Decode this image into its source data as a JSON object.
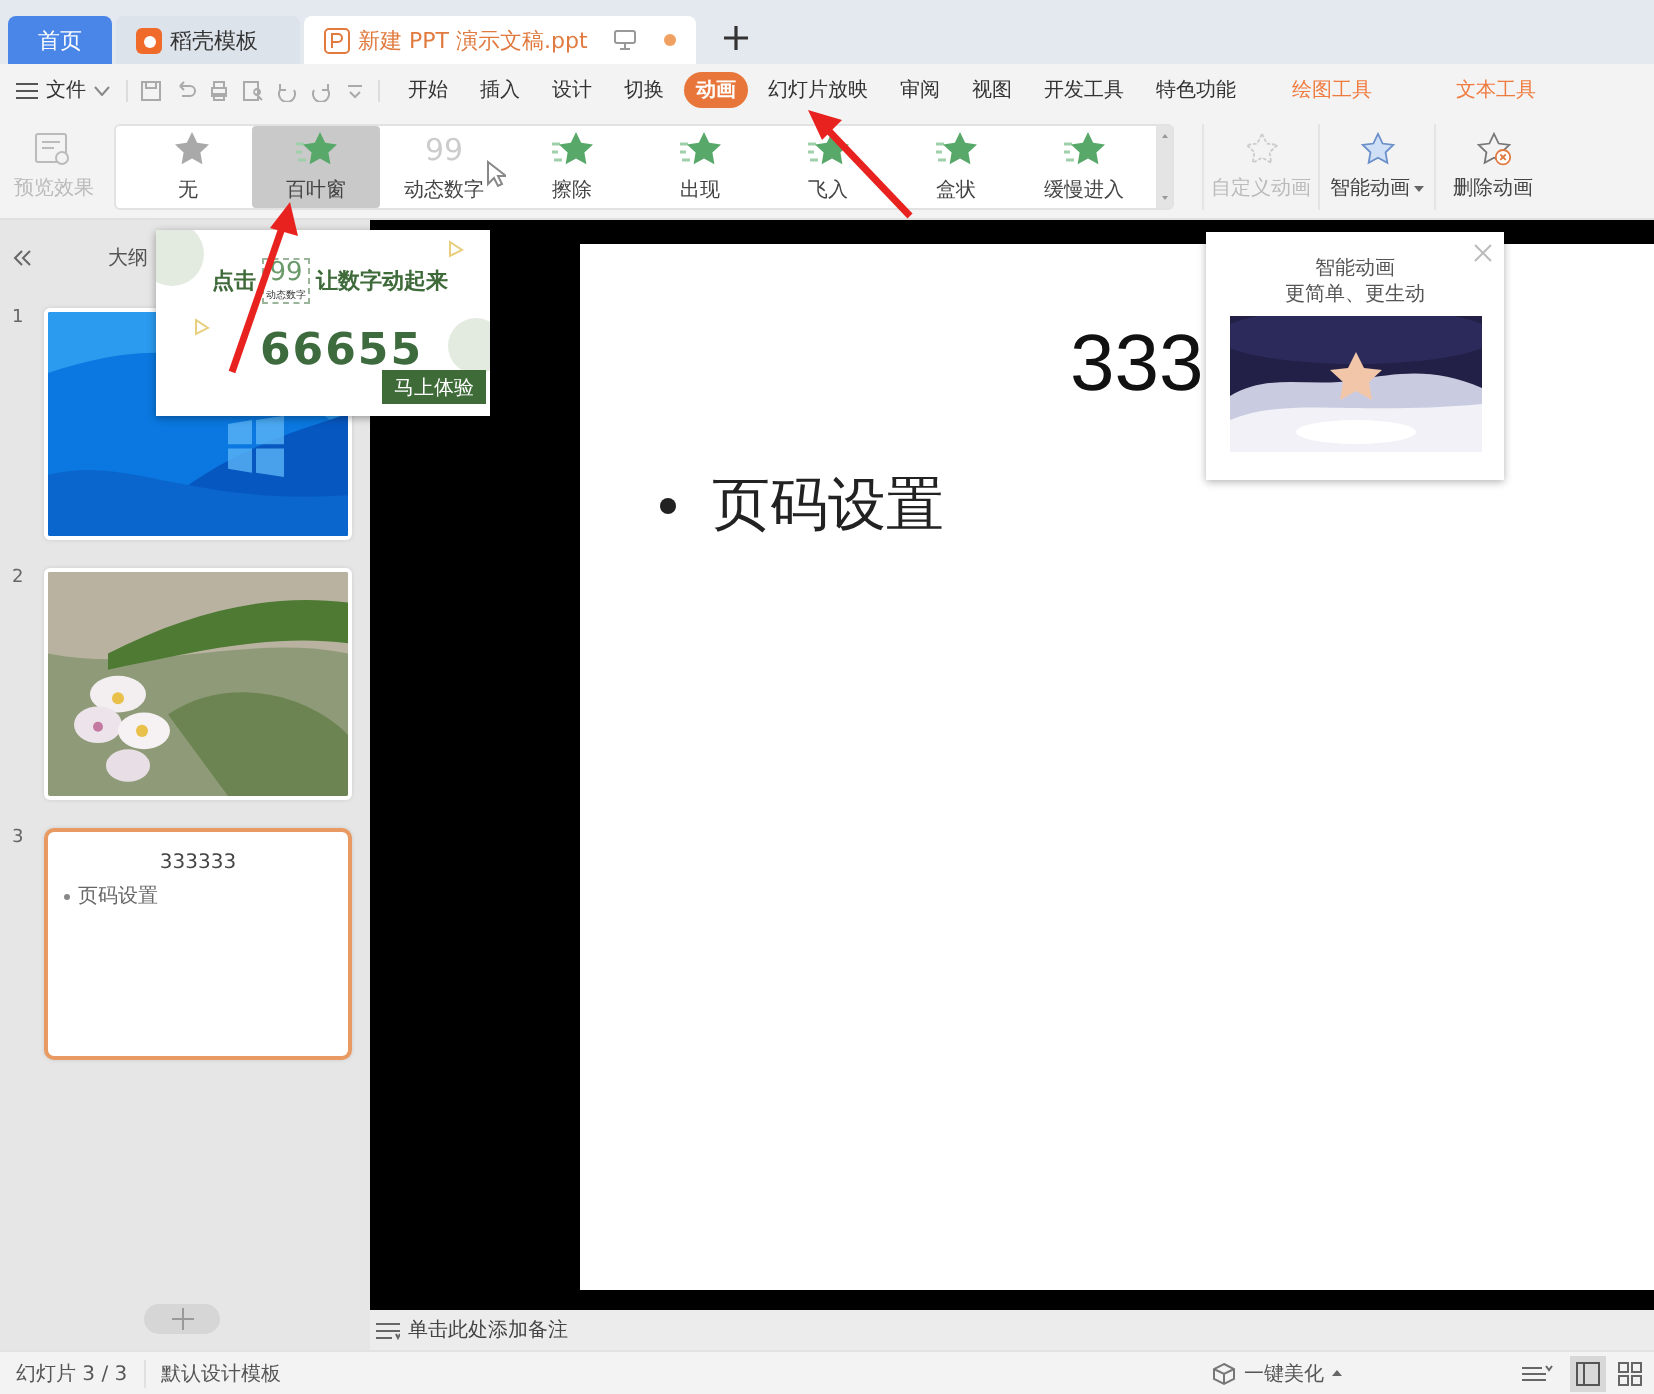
{
  "tabs": [
    {
      "label": "首页",
      "kind": "home",
      "selected": false
    },
    {
      "label": "稻壳模板",
      "kind": "store",
      "selected": false
    },
    {
      "label": "新建 PPT 演示文稿.ppt",
      "kind": "doc",
      "selected": true
    }
  ],
  "menu": {
    "file": "文件",
    "items": [
      {
        "label": "开始",
        "kind": "main",
        "selected": false
      },
      {
        "label": "插入",
        "kind": "main",
        "selected": false
      },
      {
        "label": "设计",
        "kind": "main",
        "selected": false
      },
      {
        "label": "切换",
        "kind": "main",
        "selected": false
      },
      {
        "label": "动画",
        "kind": "main",
        "selected": true
      },
      {
        "label": "幻灯片放映",
        "kind": "main",
        "selected": false
      },
      {
        "label": "审阅",
        "kind": "main",
        "selected": false
      },
      {
        "label": "视图",
        "kind": "main",
        "selected": false
      },
      {
        "label": "开发工具",
        "kind": "main",
        "selected": false
      },
      {
        "label": "特色功能",
        "kind": "main",
        "selected": false
      },
      {
        "label": "绘图工具",
        "kind": "context",
        "selected": false
      },
      {
        "label": "文本工具",
        "kind": "context",
        "selected": false
      }
    ]
  },
  "ribbon": {
    "preview": {
      "label": "预览效果",
      "disabled": true
    },
    "gallery": [
      {
        "label": "无",
        "kind": "none",
        "selected": false
      },
      {
        "label": "百叶窗",
        "kind": "star",
        "selected": true
      },
      {
        "label": "动态数字",
        "kind": "number",
        "icon_text": "99",
        "selected": false
      },
      {
        "label": "擦除",
        "kind": "star",
        "selected": false
      },
      {
        "label": "出现",
        "kind": "star",
        "selected": false
      },
      {
        "label": "飞入",
        "kind": "star",
        "selected": false
      },
      {
        "label": "盒状",
        "kind": "star",
        "selected": false
      },
      {
        "label": "缓慢进入",
        "kind": "star",
        "selected": false
      }
    ],
    "actions": [
      {
        "label": "自定义动画",
        "kind": "custom",
        "disabled": true
      },
      {
        "label": "智能动画",
        "kind": "smart",
        "disabled": false
      },
      {
        "label": "删除动画",
        "kind": "delete",
        "disabled": false
      }
    ]
  },
  "outline_label": "大纲",
  "slides": [
    {
      "number": "1",
      "kind": "picture",
      "selected": false
    },
    {
      "number": "2",
      "kind": "picture",
      "selected": false
    },
    {
      "number": "3",
      "kind": "text",
      "title": "333333",
      "bullets": [
        "页码设置"
      ],
      "selected": true
    }
  ],
  "editor": {
    "title": "333",
    "bullets": [
      "页码设置"
    ],
    "notes_placeholder": "单击此处添加备注"
  },
  "promo": {
    "text_before": "点击",
    "number_icon": "99",
    "number_caption": "动态数字",
    "text_after": "让数字动起来",
    "sample": "66655",
    "button": "马上体验"
  },
  "smart_tip": {
    "title": "智能动画",
    "subtitle": "更简单、更生动"
  },
  "status_bar": {
    "slide_counter": "幻灯片 3 / 3",
    "template": "默认设计模板",
    "beautify": "一键美化"
  }
}
